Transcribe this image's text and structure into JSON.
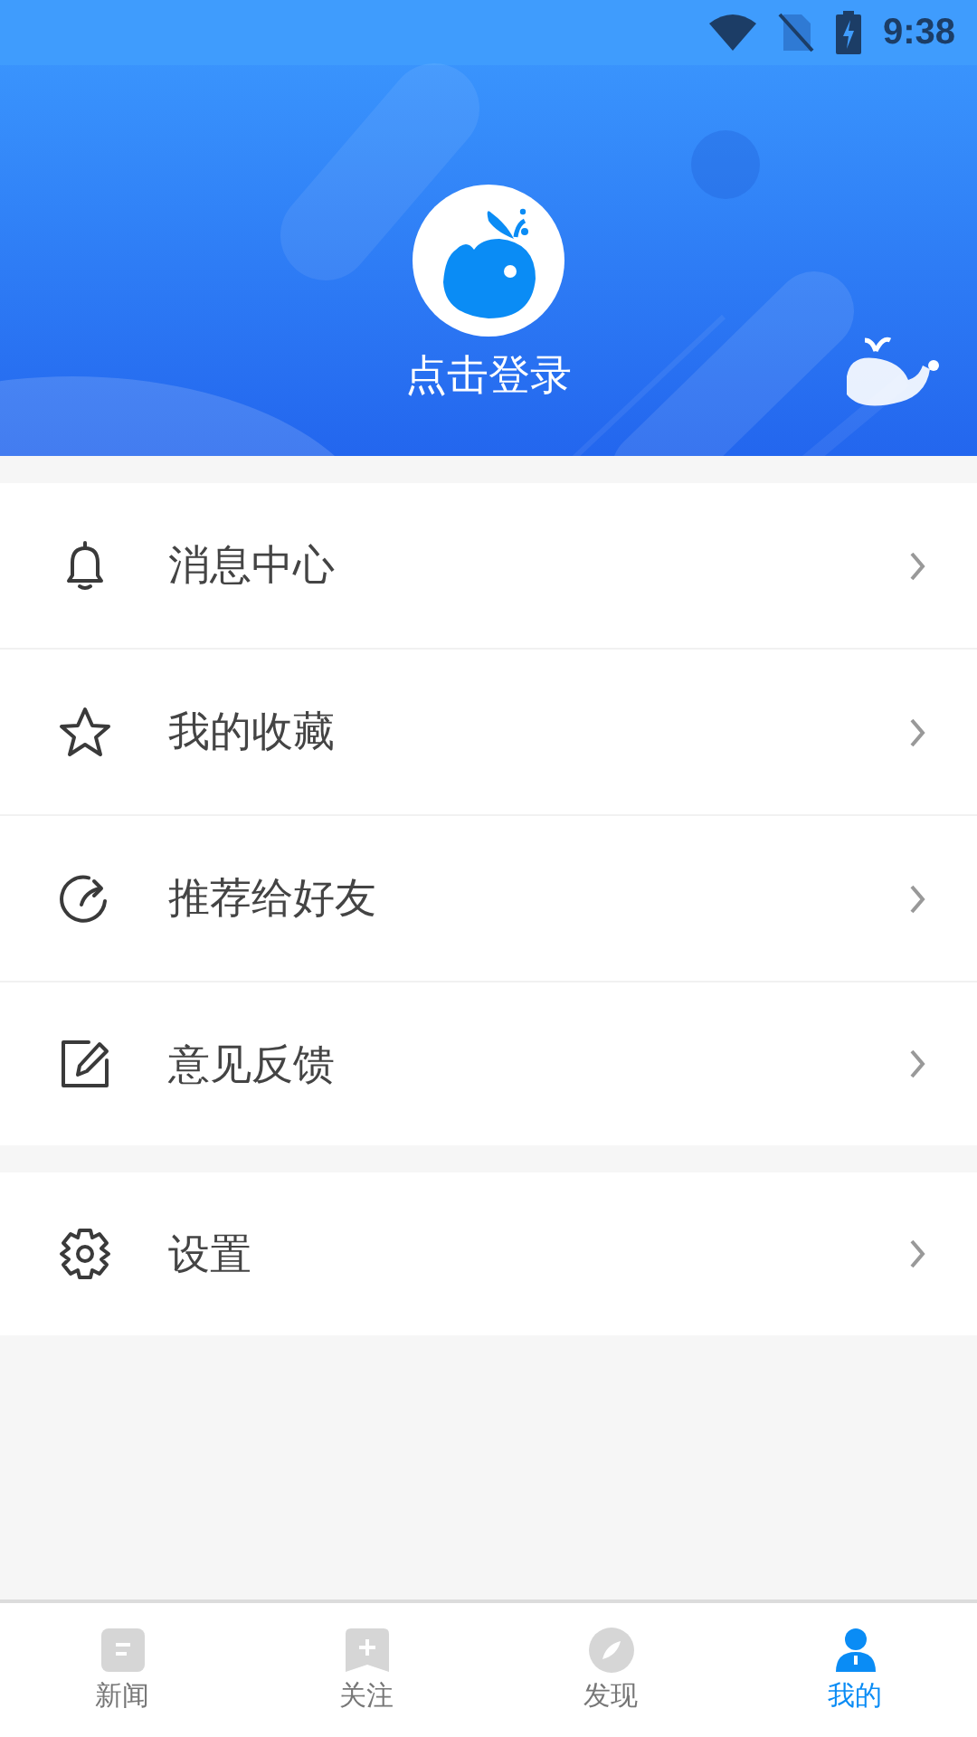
{
  "status_bar": {
    "time": "9:38"
  },
  "profile": {
    "login_label": "点击登录"
  },
  "menu_groups": [
    {
      "items": [
        {
          "label": "消息中心"
        },
        {
          "label": "我的收藏"
        },
        {
          "label": "推荐给好友"
        },
        {
          "label": "意见反馈"
        }
      ]
    },
    {
      "items": [
        {
          "label": "设置"
        }
      ]
    }
  ],
  "tabs": [
    {
      "label": "新闻",
      "selected": false
    },
    {
      "label": "关注",
      "selected": false
    },
    {
      "label": "发现",
      "selected": false
    },
    {
      "label": "我的",
      "selected": true
    }
  ]
}
